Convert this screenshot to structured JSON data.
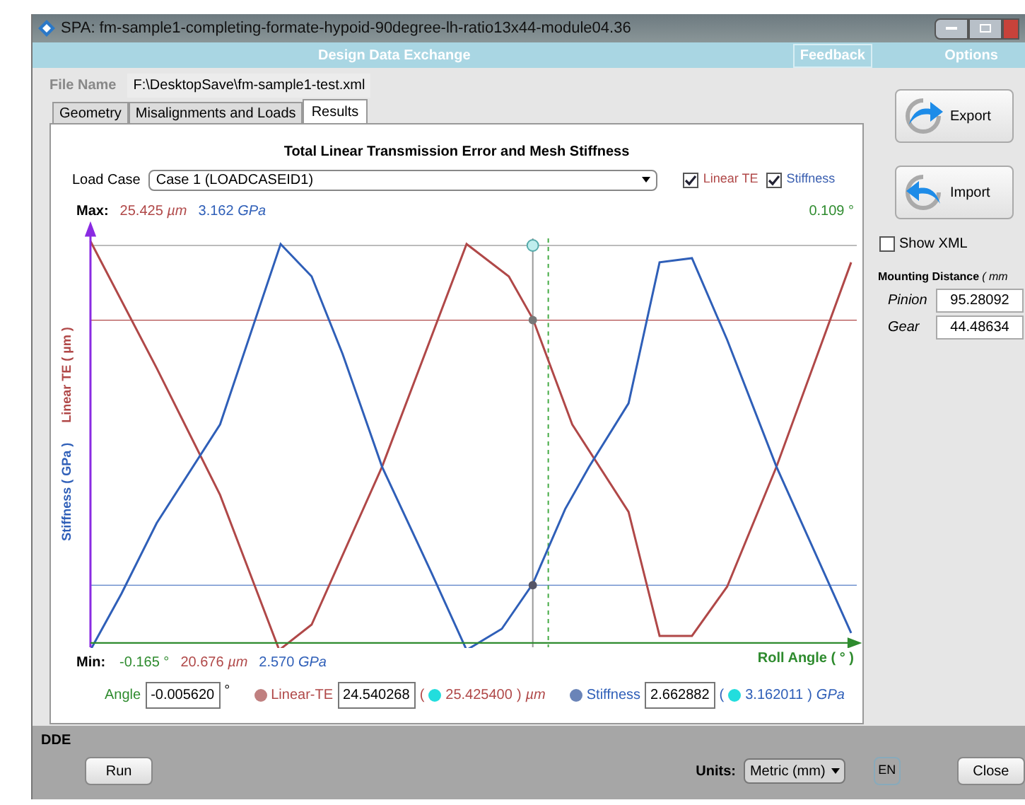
{
  "window": {
    "title": "SPA: fm-sample1-completing-formate-hypoid-90degree-lh-ratio13x44-module04.36"
  },
  "menu": [
    {
      "label": "Design Data Exchange",
      "kind": "title"
    },
    {
      "label": "Feedback",
      "kind": "link"
    },
    {
      "label": "Options",
      "kind": "link"
    }
  ],
  "file": {
    "label": "File Name",
    "value": "F:\\DesktopSave\\fm-sample1-test.xml"
  },
  "tabs": [
    {
      "label": "Geometry",
      "selected": false
    },
    {
      "label": "Misalignments and Loads",
      "selected": false
    },
    {
      "label": "Results",
      "selected": true
    }
  ],
  "results": {
    "title": "Total Linear Transmission Error and Mesh Stiffness",
    "load_case": {
      "label": "Load Case",
      "value": "Case 1 (LOADCASEID1)"
    },
    "toggles": [
      {
        "label": "Linear TE",
        "checked": true,
        "color": "#b04848"
      },
      {
        "label": "Stiffness",
        "checked": true,
        "color": "#3a5fb0"
      }
    ],
    "max": {
      "label": "Max:",
      "te": "25.425",
      "te_unit": "µm",
      "stiffness": "3.162",
      "stiffness_unit": "GPa",
      "angle": "0.109 °"
    },
    "min": {
      "label": "Min:",
      "angle": "-0.165 °",
      "te": "20.676",
      "te_unit": "µm",
      "stiffness": "2.570",
      "stiffness_unit": "GPa"
    },
    "y_axis_labels": [
      "Linear TE ( µm )",
      "Stiffness ( GPa )"
    ],
    "x_axis_label": "Roll Angle ( ° )",
    "readout": {
      "angle_label": "Angle",
      "angle": "-0.005620",
      "angle_unit": "°",
      "te_label": "Linear-TE",
      "te": "24.540268",
      "te_max": "25.425400",
      "te_unit": "µm",
      "stiffness_label": "Stiffness",
      "stiffness": "2.662882",
      "stiffness_max": "3.162011",
      "stiffness_unit": "GPa",
      "open": "(",
      "close": ")"
    }
  },
  "side": {
    "buttons": [
      "Export",
      "Import"
    ],
    "show_xml": {
      "label": "Show XML",
      "checked": false
    },
    "mounting": {
      "title": "Mounting Distance",
      "unit": "( mm",
      "rows": [
        {
          "label": "Pinion",
          "value": "95.28092"
        },
        {
          "label": "Gear",
          "value": "44.48634"
        }
      ]
    }
  },
  "footer": {
    "section": "DDE",
    "run": "Run",
    "units_label": "Units:",
    "units": "Metric (mm)",
    "language": "EN",
    "close": "Close"
  }
}
